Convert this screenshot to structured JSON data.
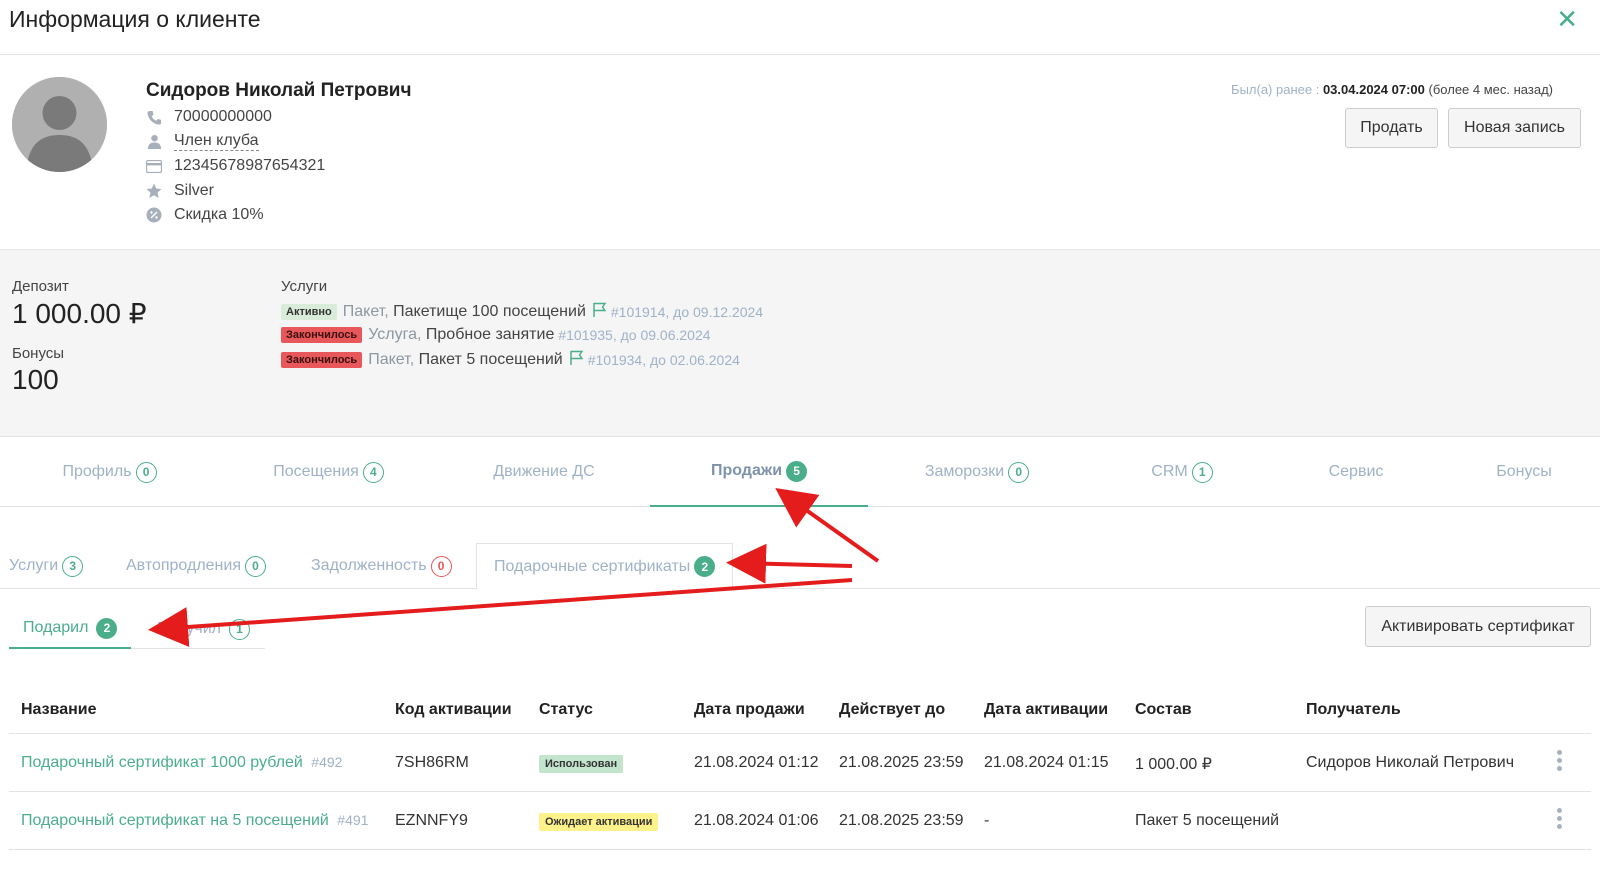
{
  "header": {
    "title": "Информация о клиенте",
    "close_glyph": "✕"
  },
  "client": {
    "name": "Сидоров Николай Петрович",
    "phone": "70000000000",
    "group": "Член клуба",
    "card": "12345678987654321",
    "level": "Silver",
    "discount": "Скидка 10%"
  },
  "last_visit": {
    "label": "Был(а) ранее :",
    "date": "03.04.2024 07:00",
    "ago": "(более 4 мес. назад)"
  },
  "actions": {
    "sell": "Продать",
    "new_record": "Новая запись"
  },
  "summary": {
    "deposit_label": "Депозит",
    "deposit_value": "1 000.00 ₽",
    "bonus_label": "Бонусы",
    "bonus_value": "100",
    "services_title": "Услуги",
    "services": [
      {
        "badge": "Активно",
        "kind": "Пакет,",
        "name": "Пакетище 100 посещений",
        "meta": "#101914, до 09.12.2024",
        "flag": true,
        "status": "active"
      },
      {
        "badge": "Закончилось",
        "kind": "Услуга,",
        "name": "Пробное занятие",
        "meta": "#101935, до 09.06.2024",
        "flag": false,
        "status": "ended"
      },
      {
        "badge": "Закончилось",
        "kind": "Пакет,",
        "name": "Пакет 5 посещений",
        "meta": "#101934, до 02.06.2024",
        "flag": true,
        "status": "ended"
      }
    ]
  },
  "main_tabs": [
    {
      "label": "Профиль",
      "count": "0"
    },
    {
      "label": "Посещения",
      "count": "4"
    },
    {
      "label": "Движение ДС",
      "count": ""
    },
    {
      "label": "Продажи",
      "count": "5"
    },
    {
      "label": "Заморозки",
      "count": "0"
    },
    {
      "label": "CRM",
      "count": "1"
    },
    {
      "label": "Сервис",
      "count": ""
    },
    {
      "label": "Бонусы",
      "count": ""
    }
  ],
  "sub_tabs": [
    {
      "label": "Услуги",
      "count": "3"
    },
    {
      "label": "Автопродления",
      "count": "0"
    },
    {
      "label": "Задолженность",
      "count": "0"
    },
    {
      "label": "Подарочные сертификаты",
      "count": "2"
    }
  ],
  "cert_tabs": [
    {
      "label": "Подарил",
      "count": "2"
    },
    {
      "label": "Получил",
      "count": "1"
    }
  ],
  "activate_button": "Активировать сертификат",
  "table": {
    "columns": [
      "Название",
      "Код активации",
      "Статус",
      "Дата продажи",
      "Действует до",
      "Дата активации",
      "Состав",
      "Получатель"
    ],
    "rows": [
      {
        "name": "Подарочный сертификат 1000 рублей",
        "id": "#492",
        "code": "7SH86RM",
        "status": "Использован",
        "sold": "21.08.2024 01:12",
        "valid": "21.08.2025 23:59",
        "activated": "21.08.2024 01:15",
        "content": "1 000.00 ₽",
        "recipient": "Сидоров Николай Петрович"
      },
      {
        "name": "Подарочный сертификат на 5 посещений",
        "id": "#491",
        "code": "EZNNFY9",
        "status": "Ожидает активации",
        "sold": "21.08.2024 01:06",
        "valid": "21.08.2025 23:59",
        "activated": "-",
        "content": "Пакет 5 посещений",
        "recipient": ""
      }
    ]
  },
  "colors": {
    "accent": "#4aae8b",
    "danger": "#e8575a",
    "muted": "#9fb2c8",
    "annotation": "#e51c1c"
  },
  "icons": [
    "phone-icon",
    "user-icon",
    "card-icon",
    "star-icon",
    "discount-icon",
    "flag-icon",
    "kebab-icon",
    "close-icon",
    "avatar-icon"
  ]
}
